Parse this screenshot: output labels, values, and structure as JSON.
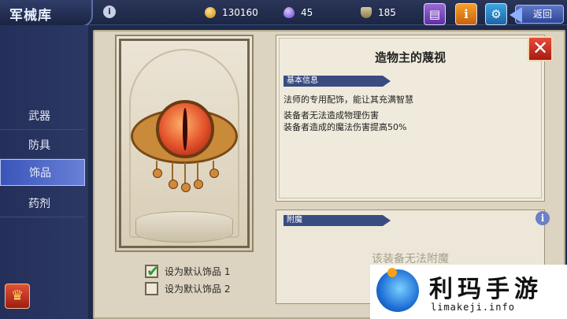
{
  "header": {
    "title": "军械库",
    "info_icon": "info-icon",
    "resources": [
      {
        "icon": "gold-coin-icon",
        "value": "130160"
      },
      {
        "icon": "crystal-icon",
        "value": "45"
      },
      {
        "icon": "shield-icon",
        "value": "185"
      }
    ],
    "back_label": "返回"
  },
  "nav": {
    "items": [
      {
        "label": "武器",
        "active": false
      },
      {
        "label": "防具",
        "active": false
      },
      {
        "label": "饰品",
        "active": true
      },
      {
        "label": "药剂",
        "active": false
      }
    ]
  },
  "item": {
    "name": "造物主的蔑视",
    "basic_info_label": "基本信息",
    "descriptions": [
      "法师的专用配饰，能让其充满智慧",
      "装备者无法造成物理伤害",
      "装备者造成的魔法伤害提高50%"
    ],
    "enchant_label": "附魔",
    "enchant_empty": "该装备无法附魔"
  },
  "defaults": [
    {
      "label": "设为默认饰品 1",
      "checked": true
    },
    {
      "label": "设为默认饰品 2",
      "checked": false
    }
  ],
  "watermark": {
    "text": "利玛手游",
    "url": "limakeji.info"
  },
  "colors": {
    "accent": "#3a55b8",
    "panel": "#dcd3c0",
    "close": "#e84a3a"
  }
}
